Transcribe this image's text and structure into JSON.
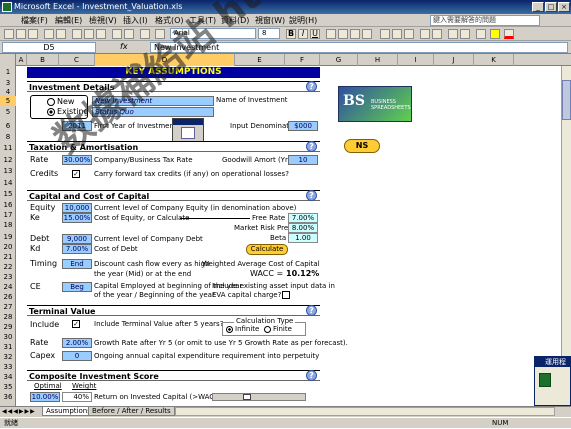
{
  "window": {
    "title": "Microsoft Excel - Investment_Valuation.xls",
    "min": "_",
    "max": "□",
    "close": "×"
  },
  "menu": {
    "items": [
      "檔案(F)",
      "編輯(E)",
      "檢視(V)",
      "插入(I)",
      "格式(O)",
      "工具(T)",
      "資料(D)",
      "視窗(W)",
      "說明(H)"
    ],
    "help_placeholder": "鍵入需要解答的問題"
  },
  "toolbar": {
    "font": "Arial",
    "size": "8"
  },
  "formula": {
    "cell": "D5",
    "fx": "fx",
    "value": "New Investment"
  },
  "columns": [
    "A",
    "B",
    "C",
    "D",
    "E",
    "F",
    "G",
    "H",
    "I",
    "J",
    "K"
  ],
  "rows": [
    "1",
    "3",
    "4",
    "5",
    "5",
    "6",
    "8",
    "11",
    "12",
    "13",
    "14",
    "15",
    "16",
    "17",
    "18",
    "19",
    "20",
    "21",
    "22",
    "23",
    "24",
    "26",
    "27",
    "28",
    "29",
    "30",
    "31",
    "32",
    "33",
    "34",
    "35",
    "36",
    "37",
    "38",
    "39",
    "40",
    "41",
    "42",
    "43",
    "44",
    "45"
  ],
  "sheet": {
    "key_assumptions": "KEY ASSUMPTIONS",
    "investment_details": "Investment Details",
    "radio_new": "New",
    "radio_existing": "Existing",
    "inv_name": "New Investment",
    "status_quo": "Status Quo",
    "name_label": "Name of Investment",
    "first_year": "2011",
    "first_year_label": "First Year of Investment",
    "input_denom_label": "Input Denomination",
    "input_denom": "$000",
    "tax_header": "Taxation & Amortisation",
    "rate_label": "Rate",
    "rate_value": "30.00%",
    "rate_desc": "Company/Business Tax Rate",
    "goodwill_label": "Goodwill Amort (Yrs)",
    "goodwill_value": "10",
    "credits_label": "Credits",
    "credits_check": "✓",
    "credits_desc": "Carry forward tax credits (if any) on operational losses?",
    "cap_header": "Capital and Cost of Capital",
    "equity_label": "Equity",
    "equity_value": "10,000",
    "equity_desc": "Current level of Company Equity (in denomination above)",
    "ke_label": "Ke",
    "ke_value": "15.00%",
    "ke_desc": "Cost of Equity, or Calculate",
    "free_rate": "Free Rate",
    "free_rate_value": "7.00%",
    "market_premium": "Market Risk Premium",
    "market_premium_value": "8.00%",
    "beta": "Beta",
    "beta_value": "1.00",
    "calc_btn": "Calculate",
    "debt_label": "Debt",
    "debt_value": "9,000",
    "debt_desc": "Current level of Company Debt",
    "kd_label": "Kd",
    "kd_value": "7.00%",
    "kd_desc": "Cost of Debt",
    "timing_label": "Timing",
    "timing_value": "End",
    "timing_desc1": "Discount cash flow every as high",
    "timing_desc2": "the year (Mid) or at the end",
    "wacc_label1": "Weighted Average Cost of Capital",
    "wacc_label": "WACC =",
    "wacc_value": "10.12%",
    "ce_label": "CE",
    "ce_value": "Beg",
    "ce_desc1": "Capital Employed at beginning of the year",
    "ce_desc2": "of the year / Beginning of the year",
    "ce_right": "Include existing asset input data in",
    "eva_label": "EVA capital charge?",
    "terminal_header": "Terminal Value",
    "include_label": "Include",
    "include_check": "✓",
    "include_desc": "Include Terminal Value after 5 years?",
    "calc_type": "Calculation Type",
    "infinite": "Infinite",
    "finite": "Finite",
    "tv_rate_label": "Rate",
    "tv_rate_value": "2.00%",
    "tv_rate_desc": "Growth Rate after Yr 5 (or omit to use Yr 5 Growth Rate as per forecast).",
    "capex_label": "Capex",
    "capex_value": "0",
    "capex_desc": "Ongoing annual capital expenditure requirement into perpetuity",
    "composite_header": "Composite Investment Score",
    "optimal_label": "Optimal",
    "weight_label": "Weight",
    "optimal_value": "10.00%",
    "weight_value": "40%",
    "roic_desc": "Return on Invested Capital (>WACC)",
    "help": "?",
    "logo_text": "BS",
    "logo_sub": "BUSINESS SPREADSHEETS",
    "nav_btn": "NS"
  },
  "tabs": [
    "Assumptions",
    "Before / After / Results"
  ],
  "status": {
    "ready": "就緒",
    "num": "NUM"
  },
  "dialog_title": "運用程",
  "watermark": "数據補給站 http://31.to"
}
